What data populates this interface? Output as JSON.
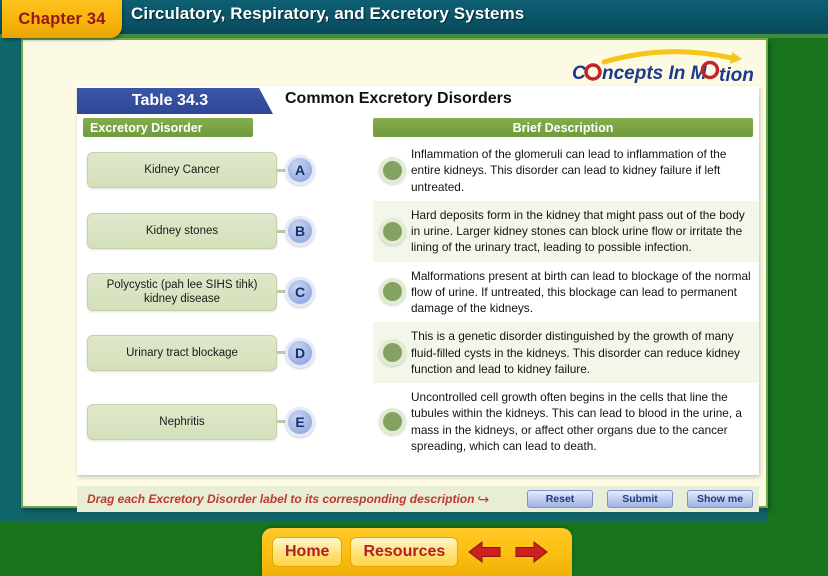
{
  "header": {
    "chapter_label": "Chapter 34",
    "course_title": "Circulatory, Respiratory, and Excretory Systems",
    "logo_text": "Concepts In Motion",
    "chapter_tab_color": "#f7b409",
    "chapter_text_color": "#93161a",
    "titlebar_color": "#0a5568"
  },
  "table": {
    "number_label": "Table 34.3",
    "caption": "Common Excretory Disorders",
    "badge_color": "#2f4796",
    "column_headers": {
      "left": "Excretory Disorder",
      "right": "Brief Description"
    },
    "header_color": "#6f9b3e",
    "rows": [
      {
        "letter": "A",
        "disorder": "Kidney Cancer",
        "description": "Inflammation of the glomeruli can lead to inflammation of the entire kidneys. This disorder can lead to kidney failure if left untreated."
      },
      {
        "letter": "B",
        "disorder": "Kidney stones",
        "description": "Hard deposits form in the kidney that might pass out of the body in urine. Larger kidney stones can block urine flow or irritate the lining of the urinary tract, leading to possible infection."
      },
      {
        "letter": "C",
        "disorder": "Polycystic (pah lee SIHS tihk) kidney disease",
        "description": "Malformations present at birth can lead to blockage of the normal flow of urine. If untreated, this blockage can lead to permanent damage of the kidneys."
      },
      {
        "letter": "D",
        "disorder": "Urinary tract blockage",
        "description": "This is a genetic disorder distinguished by the growth of many fluid-filled cysts in the kidneys. This disorder can reduce kidney function and lead to kidney failure."
      },
      {
        "letter": "E",
        "disorder": "Nephritis",
        "description": "Uncontrolled cell growth often begins in the cells that line the tubules within the kidneys. This can lead to blood in the urine, a mass in the kidneys, or affect other organs due to the cancer spreading, which can lead to death."
      }
    ]
  },
  "instruction": {
    "text": "Drag each Excretory Disorder label to its corresponding description",
    "arrow_glyph": "↪",
    "text_color": "#c0392b"
  },
  "actions": {
    "reset": "Reset",
    "submit": "Submit",
    "show_me": "Show me"
  },
  "nav": {
    "home": "Home",
    "resources": "Resources",
    "back_arrow": "back-arrow",
    "forward_arrow": "forward-arrow",
    "bar_color": "#fcbe10",
    "arrow_color": "#cc1f1f"
  }
}
